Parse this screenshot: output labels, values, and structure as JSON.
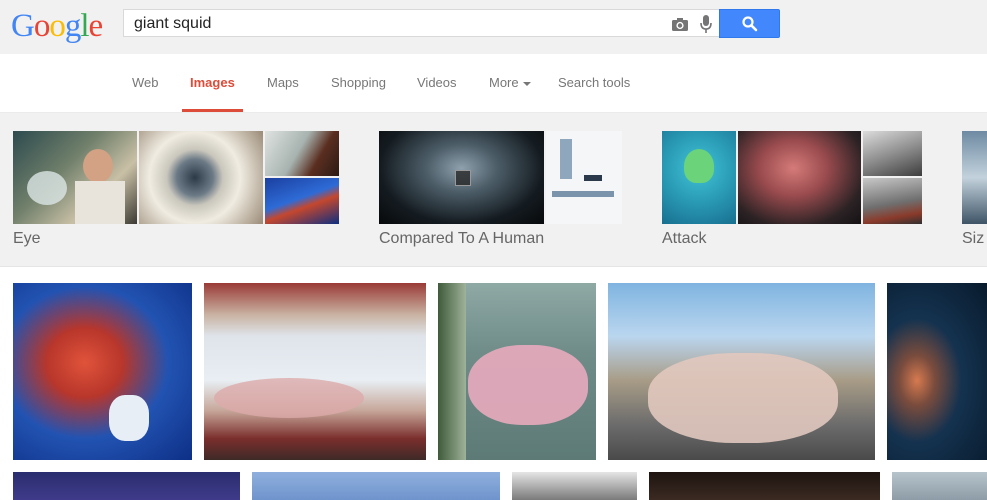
{
  "logo": {
    "letters": [
      "G",
      "o",
      "o",
      "g",
      "l",
      "e"
    ],
    "colors": [
      "#4285f4",
      "#ea4335",
      "#fbbc05",
      "#4285f4",
      "#34a853",
      "#ea4335"
    ]
  },
  "search": {
    "query": "giant squid",
    "camera_icon": "camera-icon",
    "mic_icon": "mic-icon",
    "button_icon": "search-icon"
  },
  "nav": {
    "tabs": [
      "Web",
      "Images",
      "Maps",
      "Shopping",
      "Videos",
      "More",
      "Search tools"
    ],
    "active": "Images"
  },
  "topics": [
    "Eye",
    "Compared To A Human",
    "Attack",
    "Siz"
  ],
  "colors": {
    "accent": "#dd4b39",
    "search_button": "#4387fd",
    "topbar": "#f1f1f1"
  }
}
